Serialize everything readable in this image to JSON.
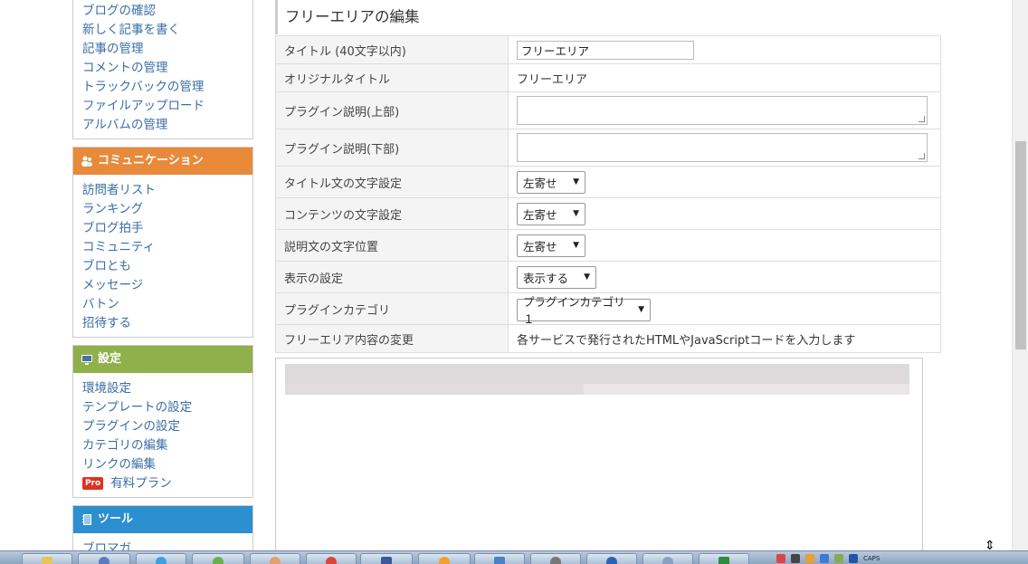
{
  "sidebar": {
    "top_links": [
      "ブログの確認",
      "新しく記事を書く",
      "記事の管理",
      "コメントの管理",
      "トラックバックの管理",
      "ファイルアップロード",
      "アルバムの管理"
    ],
    "communication": {
      "title": "コミュニケーション",
      "color": "#e88a3a",
      "links": [
        "訪問者リスト",
        "ランキング",
        "ブログ拍手",
        "コミュニティ",
        "ブロとも",
        "メッセージ",
        "バトン",
        "招待する"
      ]
    },
    "settings": {
      "title": "設定",
      "color": "#8fb04a",
      "links": [
        "環境設定",
        "テンプレートの設定",
        "プラグインの設定",
        "カテゴリの編集",
        "リンクの編集"
      ],
      "pro_badge": "Pro",
      "pro_label": "有料プラン"
    },
    "tools": {
      "title": "ツール",
      "color": "#2b8fd0",
      "links": [
        "ブロマガ"
      ]
    }
  },
  "main": {
    "title": "フリーエリアの編集",
    "rows": {
      "title_label": "タイトル (40文字以内)",
      "title_value": "フリーエリア",
      "original_label": "オリジナルタイトル",
      "original_value": "フリーエリア",
      "desc_top_label": "プラグイン説明(上部)",
      "desc_bottom_label": "プラグイン説明(下部)",
      "title_align_label": "タイトル文の文字設定",
      "title_align_value": "左寄せ",
      "content_align_label": "コンテンツの文字設定",
      "content_align_value": "左寄せ",
      "desc_align_label": "説明文の文字位置",
      "desc_align_value": "左寄せ",
      "display_label": "表示の設定",
      "display_value": "表示する",
      "category_label": "プラグインカテゴリ",
      "category_value": "プラグインカテゴリ１",
      "content_change_label": "フリーエリア内容の変更",
      "content_change_text": "各サービスで発行されたHTMLやJavaScriptコードを入力します"
    }
  },
  "taskbar": {
    "tray_caps": "CAPS"
  },
  "icons": {
    "select_caret": "▼",
    "cursor": "⇕"
  }
}
